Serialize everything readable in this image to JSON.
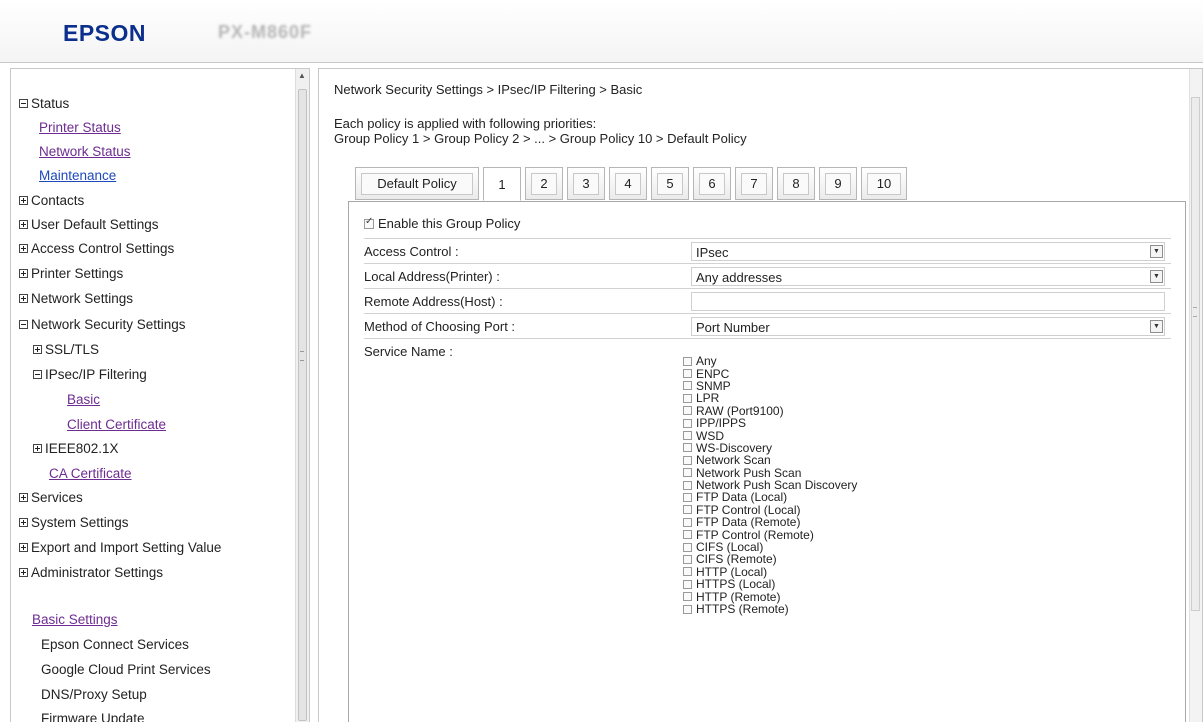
{
  "header": {
    "brand": "EPSON",
    "model": "PX-M860F"
  },
  "nav": {
    "status": "Status",
    "printer_status": "Printer Status",
    "network_status": "Network Status",
    "maintenance": "Maintenance",
    "contacts": "Contacts",
    "user_default": "User Default Settings",
    "access_control": "Access Control Settings",
    "printer_settings": "Printer Settings",
    "network_settings": "Network Settings",
    "network_security": "Network Security Settings",
    "ssl_tls": "SSL/TLS",
    "ipsec_filtering": "IPsec/IP Filtering",
    "basic": "Basic",
    "client_cert": "Client Certificate",
    "ieee": "IEEE802.1X",
    "ca_cert": "CA Certificate",
    "services": "Services",
    "system_settings": "System Settings",
    "export_import": "Export and Import Setting Value",
    "admin_settings": "Administrator Settings",
    "basic_settings": "Basic Settings",
    "epson_connect": "Epson Connect Services",
    "google_cloud": "Google Cloud Print Services",
    "dns_proxy": "DNS/Proxy Setup",
    "firmware": "Firmware Update"
  },
  "main": {
    "breadcrumb": "Network Security Settings > IPsec/IP Filtering > Basic",
    "priority_line1": "Each policy is applied with following priorities:",
    "priority_line2": "Group Policy 1 > Group Policy 2 > ... > Group Policy 10 > Default Policy",
    "tabs": [
      "Default Policy",
      "1",
      "2",
      "3",
      "4",
      "5",
      "6",
      "7",
      "8",
      "9",
      "10"
    ],
    "active_tab": "1",
    "enable_label": "Enable this Group Policy",
    "fields": {
      "access_control_label": "Access Control :",
      "access_control_value": "IPsec",
      "local_address_label": "Local Address(Printer) :",
      "local_address_value": "Any addresses",
      "remote_address_label": "Remote Address(Host) :",
      "remote_address_value": "",
      "method_label": "Method of Choosing Port :",
      "method_value": "Port Number",
      "service_name_label": "Service Name :"
    },
    "services": [
      "Any",
      "ENPC",
      "SNMP",
      "LPR",
      "RAW (Port9100)",
      "IPP/IPPS",
      "WSD",
      "WS-Discovery",
      "Network Scan",
      "Network Push Scan",
      "Network Push Scan Discovery",
      "FTP Data (Local)",
      "FTP Control (Local)",
      "FTP Data (Remote)",
      "FTP Control (Remote)",
      "CIFS (Local)",
      "CIFS (Remote)",
      "HTTP (Local)",
      "HTTPS (Local)",
      "HTTP (Remote)",
      "HTTPS (Remote)"
    ]
  }
}
